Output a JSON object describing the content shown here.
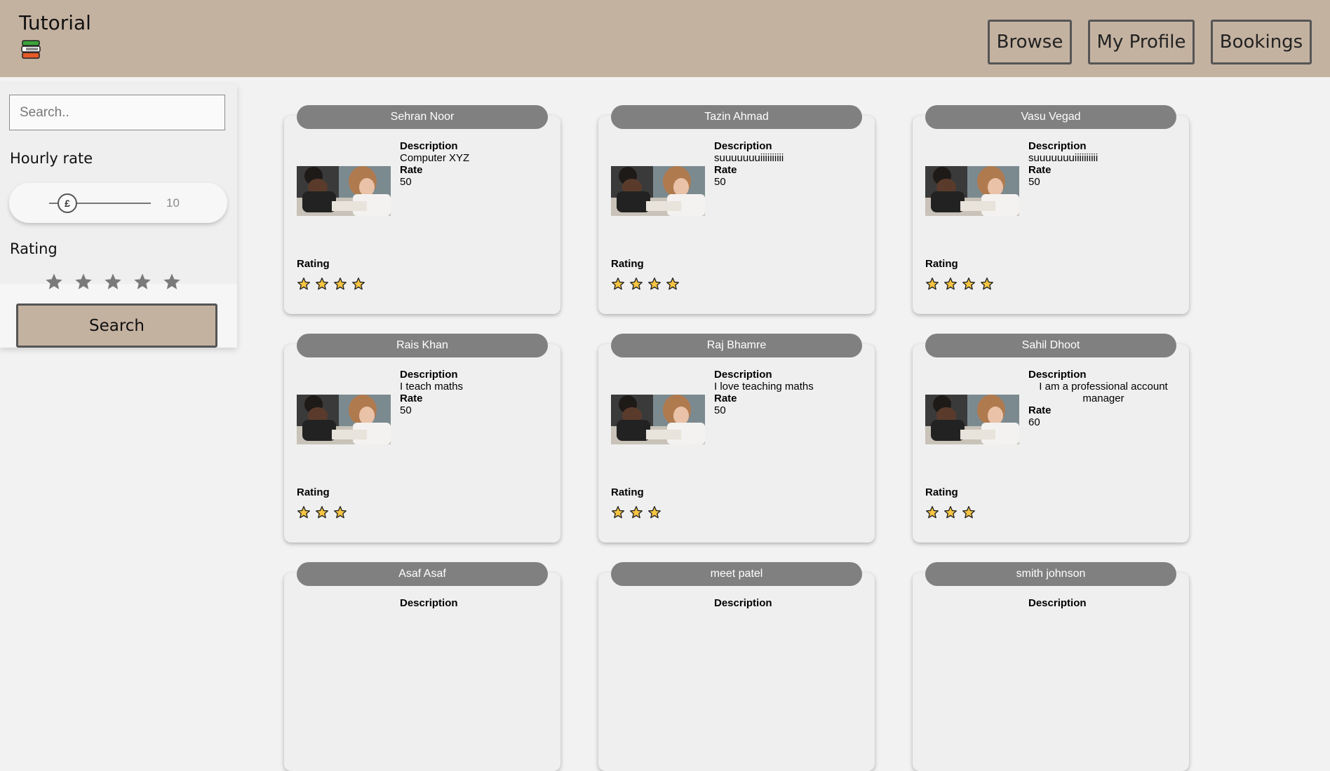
{
  "header": {
    "title": "Tutorial",
    "logo_icon": "books-icon",
    "nav": [
      {
        "label": "Browse"
      },
      {
        "label": "My Profile"
      },
      {
        "label": "Bookings"
      }
    ]
  },
  "sidebar": {
    "search_placeholder": "Search..",
    "hourly_rate_label": "Hourly rate",
    "slider_symbol": "£",
    "slider_value": "10",
    "rating_label": "Rating",
    "rating_star_icon": "star-icon",
    "rating_star_color": "#7a7a7a",
    "search_button": "Search"
  },
  "cards": [
    {
      "name": "Sehran Noor",
      "description_label": "Description",
      "description": "Computer XYZ",
      "rate_label": "Rate",
      "rate": "50",
      "rating_label": "Rating",
      "stars": 4
    },
    {
      "name": "Tazin Ahmad",
      "description_label": "Description",
      "description": "suuuuuuuiiiiiiiiii",
      "rate_label": "Rate",
      "rate": "50",
      "rating_label": "Rating",
      "stars": 4
    },
    {
      "name": "Vasu Vegad",
      "description_label": "Description",
      "description": "suuuuuuuiiiiiiiiii",
      "rate_label": "Rate",
      "rate": "50",
      "rating_label": "Rating",
      "stars": 4
    },
    {
      "name": "Rais Khan",
      "description_label": "Description",
      "description": "I teach maths",
      "rate_label": "Rate",
      "rate": "50",
      "rating_label": "Rating",
      "stars": 3
    },
    {
      "name": "Raj Bhamre",
      "description_label": "Description",
      "description": "I love teaching maths",
      "rate_label": "Rate",
      "rate": "50",
      "rating_label": "Rating",
      "stars": 3
    },
    {
      "name": "Sahil Dhoot",
      "description_label": "Description",
      "description": "I am a professional account manager",
      "rate_label": "Rate",
      "rate": "60",
      "rating_label": "Rating",
      "stars": 3
    },
    {
      "name": "Asaf Asaf",
      "description_label": "Description"
    },
    {
      "name": "meet patel",
      "description_label": "Description"
    },
    {
      "name": "smith johnson",
      "description_label": "Description"
    }
  ],
  "colors": {
    "header_bg": "#c4b2a1",
    "name_pill": "#808080",
    "star_fill": "#f5c542"
  }
}
